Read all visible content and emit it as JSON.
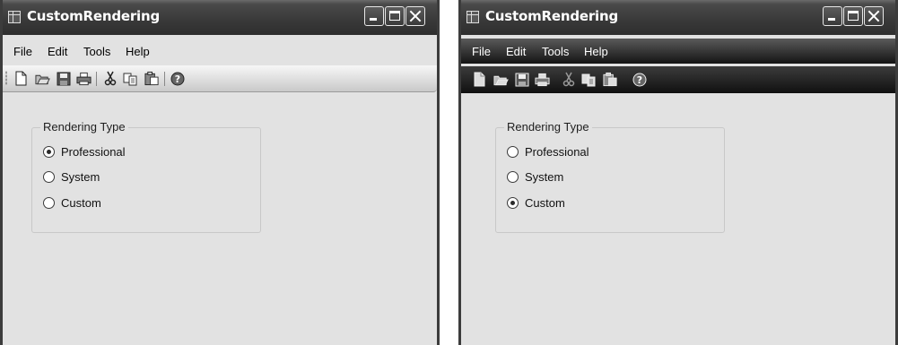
{
  "windows": [
    {
      "title": "CustomRendering",
      "menu": [
        "File",
        "Edit",
        "Tools",
        "Help"
      ],
      "toolbar_icons": [
        "new-document-icon",
        "open-folder-icon",
        "save-icon",
        "print-icon",
        "cut-icon",
        "copy-icon",
        "paste-icon",
        "help-icon"
      ],
      "group": {
        "label": "Rendering Type",
        "options": [
          "Professional",
          "System",
          "Custom"
        ],
        "selected": "Professional"
      }
    },
    {
      "title": "CustomRendering",
      "menu": [
        "File",
        "Edit",
        "Tools",
        "Help"
      ],
      "toolbar_icons": [
        "new-document-icon",
        "open-folder-icon",
        "save-icon",
        "print-icon",
        "cut-icon",
        "copy-icon",
        "paste-icon",
        "help-icon"
      ],
      "group": {
        "label": "Rendering Type",
        "options": [
          "Professional",
          "System",
          "Custom"
        ],
        "selected": "Custom"
      }
    }
  ]
}
